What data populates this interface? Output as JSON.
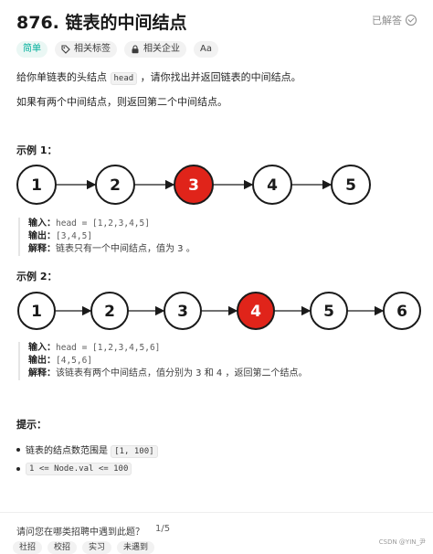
{
  "problem": {
    "title": "876. 链表的中间结点",
    "solved_label": "已解答",
    "tags": {
      "difficulty": "简单",
      "topics": "相关标签",
      "companies": "相关企业",
      "font_size": "Aa"
    }
  },
  "description": {
    "line1_pre": "给你单链表的头结点 ",
    "line1_code": "head",
    "line1_post": " ，请你找出并返回链表的中间结点。",
    "line2": "如果有两个中间结点，则返回第二个中间结点。"
  },
  "examples": [
    {
      "heading": "示例 1：",
      "nodes": [
        "1",
        "2",
        "3",
        "4",
        "5"
      ],
      "highlight_index": 2,
      "input_label": "输入：",
      "input_value": "head = [1,2,3,4,5]",
      "output_label": "输出：",
      "output_value": "[3,4,5]",
      "explain_label": "解释：",
      "explain_value": "链表只有一个中间结点，值为 3 。"
    },
    {
      "heading": "示例 2：",
      "nodes": [
        "1",
        "2",
        "3",
        "4",
        "5",
        "6"
      ],
      "highlight_index": 3,
      "input_label": "输入：",
      "input_value": "head = [1,2,3,4,5,6]",
      "output_label": "输出：",
      "output_value": "[4,5,6]",
      "explain_label": "解释：",
      "explain_value": "该链表有两个中间结点，值分别为 3 和 4 ，返回第二个结点。"
    }
  ],
  "hints": {
    "heading": "提示：",
    "items": [
      {
        "pre": "链表的结点数范围是 ",
        "code": "[1, 100]"
      },
      {
        "pre": "",
        "code": "1 <= Node.val <= 100"
      }
    ]
  },
  "footer": {
    "question": "请问您在哪类招聘中遇到此题？",
    "counter": "1/5",
    "chips": [
      "社招",
      "校招",
      "实习",
      "未遇到"
    ],
    "watermark": "CSDN @YIN_尹"
  },
  "colors": {
    "highlight_fill": "#e0241a",
    "node_fill": "#ffffff",
    "node_stroke": "#1a1a1a",
    "easy_green": "#00af9b"
  }
}
